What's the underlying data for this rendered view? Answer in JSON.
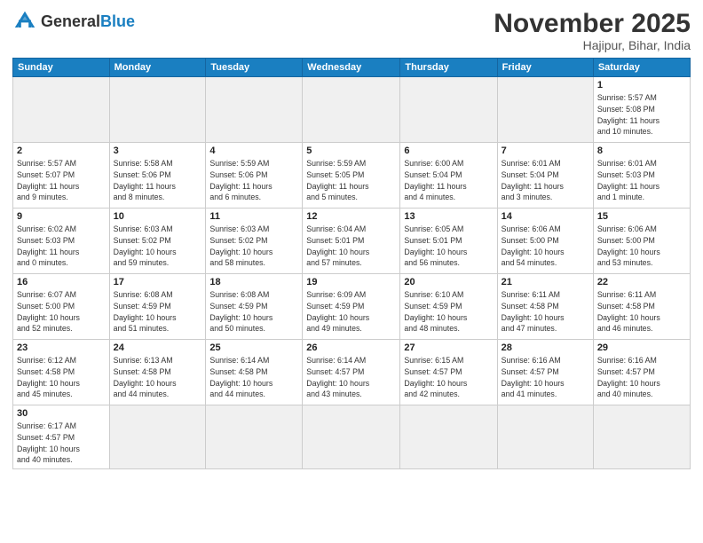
{
  "header": {
    "logo_general": "General",
    "logo_blue": "Blue",
    "month_title": "November 2025",
    "location": "Hajipur, Bihar, India"
  },
  "days_of_week": [
    "Sunday",
    "Monday",
    "Tuesday",
    "Wednesday",
    "Thursday",
    "Friday",
    "Saturday"
  ],
  "weeks": [
    [
      {
        "day": "",
        "info": "",
        "empty": true
      },
      {
        "day": "",
        "info": "",
        "empty": true
      },
      {
        "day": "",
        "info": "",
        "empty": true
      },
      {
        "day": "",
        "info": "",
        "empty": true
      },
      {
        "day": "",
        "info": "",
        "empty": true
      },
      {
        "day": "",
        "info": "",
        "empty": true
      },
      {
        "day": "1",
        "info": "Sunrise: 5:57 AM\nSunset: 5:08 PM\nDaylight: 11 hours\nand 10 minutes."
      }
    ],
    [
      {
        "day": "2",
        "info": "Sunrise: 5:57 AM\nSunset: 5:07 PM\nDaylight: 11 hours\nand 9 minutes."
      },
      {
        "day": "3",
        "info": "Sunrise: 5:58 AM\nSunset: 5:06 PM\nDaylight: 11 hours\nand 8 minutes."
      },
      {
        "day": "4",
        "info": "Sunrise: 5:59 AM\nSunset: 5:06 PM\nDaylight: 11 hours\nand 6 minutes."
      },
      {
        "day": "5",
        "info": "Sunrise: 5:59 AM\nSunset: 5:05 PM\nDaylight: 11 hours\nand 5 minutes."
      },
      {
        "day": "6",
        "info": "Sunrise: 6:00 AM\nSunset: 5:04 PM\nDaylight: 11 hours\nand 4 minutes."
      },
      {
        "day": "7",
        "info": "Sunrise: 6:01 AM\nSunset: 5:04 PM\nDaylight: 11 hours\nand 3 minutes."
      },
      {
        "day": "8",
        "info": "Sunrise: 6:01 AM\nSunset: 5:03 PM\nDaylight: 11 hours\nand 1 minute."
      }
    ],
    [
      {
        "day": "9",
        "info": "Sunrise: 6:02 AM\nSunset: 5:03 PM\nDaylight: 11 hours\nand 0 minutes."
      },
      {
        "day": "10",
        "info": "Sunrise: 6:03 AM\nSunset: 5:02 PM\nDaylight: 10 hours\nand 59 minutes."
      },
      {
        "day": "11",
        "info": "Sunrise: 6:03 AM\nSunset: 5:02 PM\nDaylight: 10 hours\nand 58 minutes."
      },
      {
        "day": "12",
        "info": "Sunrise: 6:04 AM\nSunset: 5:01 PM\nDaylight: 10 hours\nand 57 minutes."
      },
      {
        "day": "13",
        "info": "Sunrise: 6:05 AM\nSunset: 5:01 PM\nDaylight: 10 hours\nand 56 minutes."
      },
      {
        "day": "14",
        "info": "Sunrise: 6:06 AM\nSunset: 5:00 PM\nDaylight: 10 hours\nand 54 minutes."
      },
      {
        "day": "15",
        "info": "Sunrise: 6:06 AM\nSunset: 5:00 PM\nDaylight: 10 hours\nand 53 minutes."
      }
    ],
    [
      {
        "day": "16",
        "info": "Sunrise: 6:07 AM\nSunset: 5:00 PM\nDaylight: 10 hours\nand 52 minutes."
      },
      {
        "day": "17",
        "info": "Sunrise: 6:08 AM\nSunset: 4:59 PM\nDaylight: 10 hours\nand 51 minutes."
      },
      {
        "day": "18",
        "info": "Sunrise: 6:08 AM\nSunset: 4:59 PM\nDaylight: 10 hours\nand 50 minutes."
      },
      {
        "day": "19",
        "info": "Sunrise: 6:09 AM\nSunset: 4:59 PM\nDaylight: 10 hours\nand 49 minutes."
      },
      {
        "day": "20",
        "info": "Sunrise: 6:10 AM\nSunset: 4:59 PM\nDaylight: 10 hours\nand 48 minutes."
      },
      {
        "day": "21",
        "info": "Sunrise: 6:11 AM\nSunset: 4:58 PM\nDaylight: 10 hours\nand 47 minutes."
      },
      {
        "day": "22",
        "info": "Sunrise: 6:11 AM\nSunset: 4:58 PM\nDaylight: 10 hours\nand 46 minutes."
      }
    ],
    [
      {
        "day": "23",
        "info": "Sunrise: 6:12 AM\nSunset: 4:58 PM\nDaylight: 10 hours\nand 45 minutes."
      },
      {
        "day": "24",
        "info": "Sunrise: 6:13 AM\nSunset: 4:58 PM\nDaylight: 10 hours\nand 44 minutes."
      },
      {
        "day": "25",
        "info": "Sunrise: 6:14 AM\nSunset: 4:58 PM\nDaylight: 10 hours\nand 44 minutes."
      },
      {
        "day": "26",
        "info": "Sunrise: 6:14 AM\nSunset: 4:57 PM\nDaylight: 10 hours\nand 43 minutes."
      },
      {
        "day": "27",
        "info": "Sunrise: 6:15 AM\nSunset: 4:57 PM\nDaylight: 10 hours\nand 42 minutes."
      },
      {
        "day": "28",
        "info": "Sunrise: 6:16 AM\nSunset: 4:57 PM\nDaylight: 10 hours\nand 41 minutes."
      },
      {
        "day": "29",
        "info": "Sunrise: 6:16 AM\nSunset: 4:57 PM\nDaylight: 10 hours\nand 40 minutes."
      }
    ],
    [
      {
        "day": "30",
        "info": "Sunrise: 6:17 AM\nSunset: 4:57 PM\nDaylight: 10 hours\nand 40 minutes.",
        "last": true
      },
      {
        "day": "",
        "info": "",
        "empty": true,
        "last": true
      },
      {
        "day": "",
        "info": "",
        "empty": true,
        "last": true
      },
      {
        "day": "",
        "info": "",
        "empty": true,
        "last": true
      },
      {
        "day": "",
        "info": "",
        "empty": true,
        "last": true
      },
      {
        "day": "",
        "info": "",
        "empty": true,
        "last": true
      },
      {
        "day": "",
        "info": "",
        "empty": true,
        "last": true
      }
    ]
  ]
}
